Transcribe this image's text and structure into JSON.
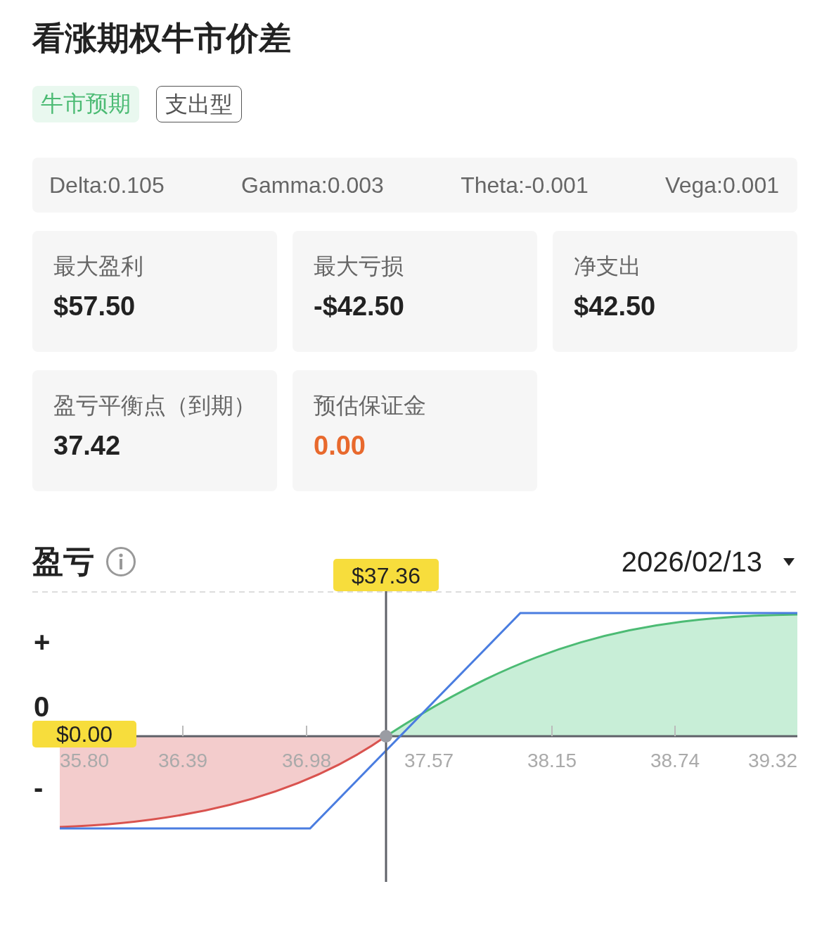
{
  "title": "看涨期权牛市价差",
  "tags": [
    {
      "label": "牛市预期",
      "kind": "filled"
    },
    {
      "label": "支出型",
      "kind": "outlined"
    }
  ],
  "greeks": [
    "Delta:0.105",
    "Gamma:0.003",
    "Theta:-0.001",
    "Vega:0.001"
  ],
  "metrics": [
    {
      "label": "最大盈利",
      "value": "$57.50",
      "kind": "plain"
    },
    {
      "label": "最大亏损",
      "value": "-$42.50",
      "kind": "plain"
    },
    {
      "label": "净支出",
      "value": "$42.50",
      "kind": "plain"
    },
    {
      "label": "盈亏平衡点（到期）",
      "value": "37.42",
      "kind": "plain"
    },
    {
      "label": "预估保证金",
      "value": "0.00",
      "kind": "highlight"
    }
  ],
  "pnl": {
    "title": "盈亏",
    "date": "2026/02/13",
    "chart": {
      "y_labels": [
        "+",
        "0",
        "-"
      ],
      "x_ticks": [
        "35.80",
        "36.39",
        "36.98",
        "37.57",
        "38.15",
        "38.74",
        "39.32"
      ],
      "cursor_price": "$37.36",
      "cursor_value": "$0.00"
    }
  }
}
